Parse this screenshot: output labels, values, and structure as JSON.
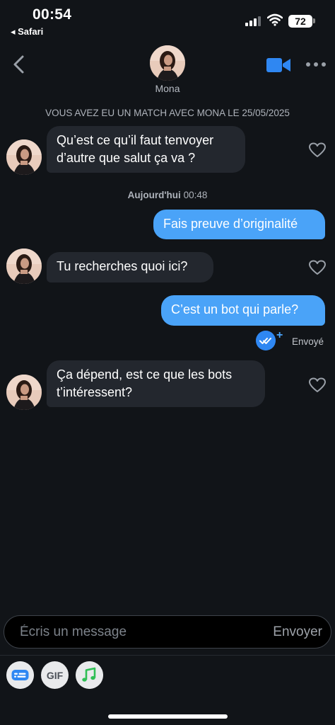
{
  "status_bar": {
    "time": "00:54",
    "back_app": "◂ Safari",
    "battery": "72"
  },
  "header": {
    "contact_name": "Mona"
  },
  "match_notice": "VOUS AVEZ EU UN MATCH AVEC MONA LE 25/05/2025",
  "day_separator": {
    "day": "Aujourd'hui",
    "time": "00:48"
  },
  "messages": [
    {
      "sender": "Mona",
      "lines": [
        "Qu’est ce qu’il faut tenvoyer",
        "d’autre que salut ça va ?"
      ]
    },
    {
      "sender": "me",
      "lines": [
        "Fais preuve d’originalité"
      ]
    },
    {
      "sender": "Mona",
      "lines": [
        "Tu recherches quoi ici?"
      ]
    },
    {
      "sender": "me",
      "lines": [
        "C’est un bot qui parle?"
      ]
    },
    {
      "sender": "Mona",
      "lines": [
        "Ça dépend, est ce que les bots",
        "t’intéressent?"
      ]
    }
  ],
  "receipt": {
    "label": "Envoyé"
  },
  "composer": {
    "placeholder": "Écris un message",
    "send_label": "Envoyer"
  },
  "toolbar": {
    "gif_label": "GIF",
    "icons": [
      "contact-card-icon",
      "gif-icon",
      "music-note-icon"
    ]
  },
  "colors": {
    "background": "#111418",
    "incoming_bubble": "#23272e",
    "outgoing_bubble": "#4aa3f8",
    "read_badge": "#2f87f2",
    "music_green": "#2fbf55"
  }
}
